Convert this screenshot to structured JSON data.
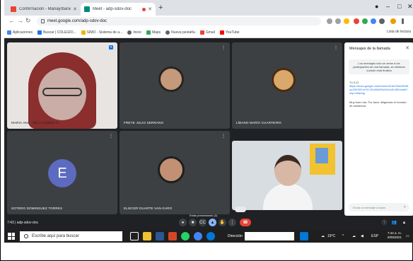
{
  "browser": {
    "tabs": [
      {
        "label": "Confirmación - Mariayrbanega...",
        "active": false
      },
      {
        "label": "Meet - adp-sdov-doc",
        "active": true
      }
    ],
    "url": "meet.google.com/adp-sdov-doc",
    "bookmarks": [
      {
        "label": "Aplicaciones",
        "icon": "apps-icon",
        "color": "#4285f4"
      },
      {
        "label": "Buscar | COLEGIO...",
        "icon": "school-icon",
        "color": "#1a73e8"
      },
      {
        "label": "SIMO - Sistema de a...",
        "icon": "folder-icon",
        "color": "#f4b400"
      },
      {
        "label": "Inicio",
        "icon": "globe-icon",
        "color": "#5f6368"
      },
      {
        "label": "Maps",
        "icon": "maps-icon",
        "color": "#34a853"
      },
      {
        "label": "Nueva pestaña",
        "icon": "globe-icon",
        "color": "#5f6368"
      },
      {
        "label": "Gmail",
        "icon": "gmail-icon",
        "color": "#ea4335"
      },
      {
        "label": "YouTube",
        "icon": "youtube-icon",
        "color": "#ff0000"
      }
    ],
    "reading_list": "Lista de lectura"
  },
  "participants": [
    {
      "name": "MARIA ANA...DE LA CUEVA T...",
      "type": "photo",
      "tone": "#c9ada6",
      "hair": "#8a2e2e"
    },
    {
      "name": "FREYE JULIO SERRANO",
      "type": "photo",
      "tone": "#c49a7a",
      "hair": "#2b2320"
    },
    {
      "name": "LÍBANO MARÍA CUARTEIRO",
      "type": "photo",
      "tone": "#d9a86a",
      "hair": "#4a2c12"
    },
    {
      "name": "SOTERO DOMINGUEZ TORRES",
      "type": "letter",
      "letter": "E",
      "color": "#5c6bc0"
    },
    {
      "name": "ELIECER DUARTE VAN-GARO",
      "type": "photo",
      "tone": "#c29073",
      "hair": "#1e1e1e"
    },
    {
      "name": "",
      "type": "self",
      "tone": "#d8b8a4",
      "hair": "#3b2a22"
    }
  ],
  "chat": {
    "title": "Mensajes de la llamada",
    "notice": "Los mensajes sólo se verán a los participantes de una llamada, se eliminan cuando esta finaliza",
    "messages": [
      {
        "sender": "Tú 3:11",
        "text": "https://docs.google.com/forms/d/1dh2ZaxHEd8ucJ9HX5YzX3J-2KzN9vR4zSnXsZr49Ez/edit?usp=sharing"
      },
      {
        "sender": "",
        "text": "Muy buen día. Por favor diligenciar el formato de asistencia"
      }
    ],
    "input_placeholder": "Envía un mensaje a todos"
  },
  "meet": {
    "code": "7:43 | adp-sdov-doc",
    "present_label": "Estás presentando (2)"
  },
  "taskbar": {
    "search_placeholder": "Escribe aquí para buscar",
    "direction_label": "Dirección",
    "weather": "19°C",
    "language": "ESP",
    "time": "7:42 a. m.",
    "date": "8/09/2021"
  }
}
